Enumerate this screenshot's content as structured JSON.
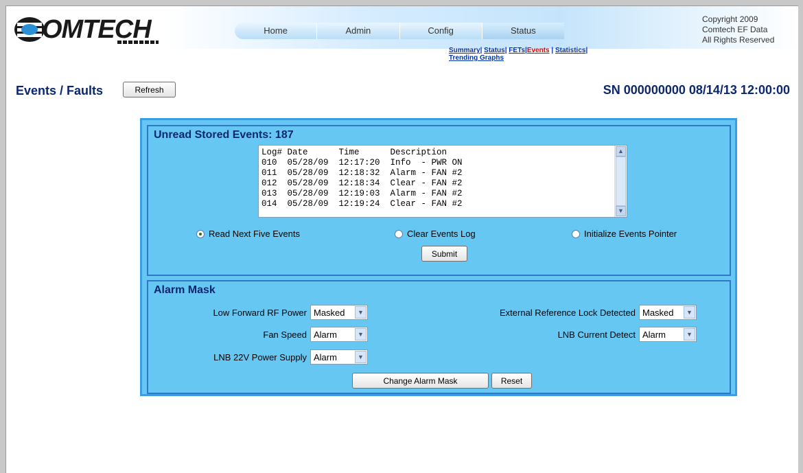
{
  "brand": {
    "name": "OMTECH"
  },
  "copyright": [
    "Copyright 2009",
    "Comtech EF Data",
    "All Rights Reserved"
  ],
  "nav": {
    "tabs": [
      {
        "label": "Home",
        "active": false
      },
      {
        "label": "Admin",
        "active": false
      },
      {
        "label": "Config",
        "active": false
      },
      {
        "label": "Status",
        "active": true
      }
    ],
    "subnav": [
      "Summary",
      "Status",
      "FETs",
      "Events",
      "Statistics",
      "Trending Graphs"
    ],
    "subnav_current": "Events"
  },
  "page": {
    "title": "Events / Faults",
    "refresh_label": "Refresh",
    "serial_line": "SN 000000000 08/14/13 12:00:00"
  },
  "events": {
    "title": "Unread Stored Events: 187",
    "header": "Log# Date      Time      Description",
    "rows": [
      "010  05/28/09  12:17:20  Info  - PWR ON",
      "011  05/28/09  12:18:32  Alarm - FAN #2",
      "012  05/28/09  12:18:34  Clear - FAN #2",
      "013  05/28/09  12:19:03  Alarm - FAN #2",
      "014  05/28/09  12:19:24  Clear - FAN #2"
    ],
    "options": [
      {
        "label": "Read Next Five Events",
        "checked": true
      },
      {
        "label": "Clear Events Log",
        "checked": false
      },
      {
        "label": "Initialize Events Pointer",
        "checked": false
      }
    ],
    "submit_label": "Submit"
  },
  "alarm_mask": {
    "title": "Alarm Mask",
    "fields": [
      {
        "label": "Low Forward RF Power",
        "value": "Masked"
      },
      {
        "label": "Fan Speed",
        "value": "Alarm"
      },
      {
        "label": "LNB 22V Power Supply",
        "value": "Alarm"
      },
      {
        "label": "External Reference Lock Detected",
        "value": "Masked"
      },
      {
        "label": "LNB Current Detect",
        "value": "Alarm"
      }
    ],
    "change_label": "Change Alarm Mask",
    "reset_label": "Reset"
  },
  "colors": {
    "panel": "#66c8f2",
    "panel_border": "#2f78c5",
    "title_text": "#0a2770",
    "link": "#0033aa",
    "link_current": "#e00000"
  }
}
